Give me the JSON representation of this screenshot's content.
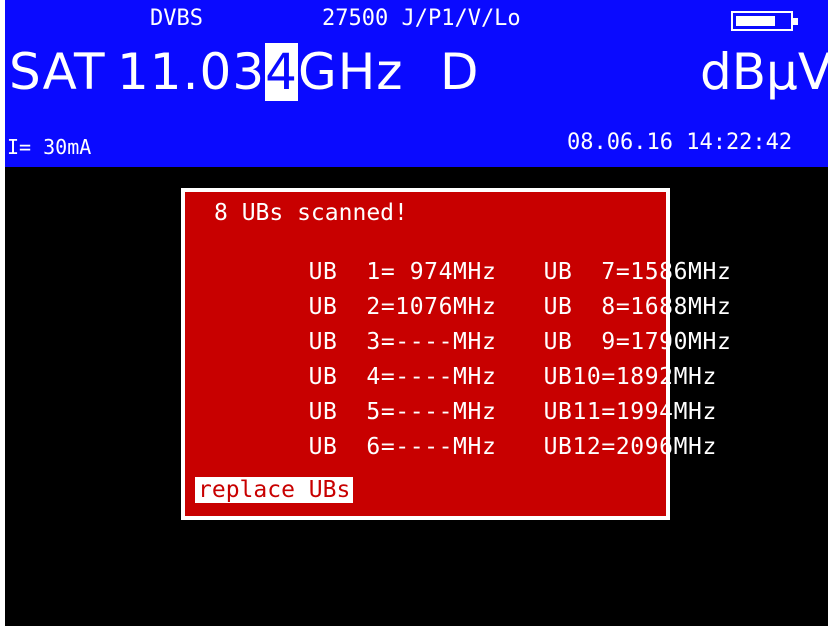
{
  "header": {
    "mode": "DVBS",
    "params": "27500 J/P1/V/Lo",
    "band": "SAT",
    "frequency": {
      "before_cursor": "11.03",
      "cursor_digit": "4",
      "unit": "GHz"
    },
    "demod_flag": "D",
    "level_unit": "dBµV",
    "lnb_current": "I= 30mA",
    "datetime": "08.06.16 14:22:42",
    "battery_level": 0.75
  },
  "dialog": {
    "message": "8 UBs scanned!",
    "rows": [
      {
        "left": "UB  1= 974MHz",
        "right": "UB  7=1586MHz"
      },
      {
        "left": "UB  2=1076MHz",
        "right": "UB  8=1688MHz"
      },
      {
        "left": "UB  3=----MHz",
        "right": "UB  9=1790MHz"
      },
      {
        "left": "UB  4=----MHz",
        "right": "UB10=1892MHz"
      },
      {
        "left": "UB  5=----MHz",
        "right": "UB11=1994MHz"
      },
      {
        "left": "UB  6=----MHz",
        "right": "UB12=2096MHz"
      }
    ],
    "replace_label": "replace UBs"
  },
  "colors": {
    "header_bg": "#0a0aff",
    "dialog_bg": "#c80000",
    "text": "#ffffff"
  }
}
